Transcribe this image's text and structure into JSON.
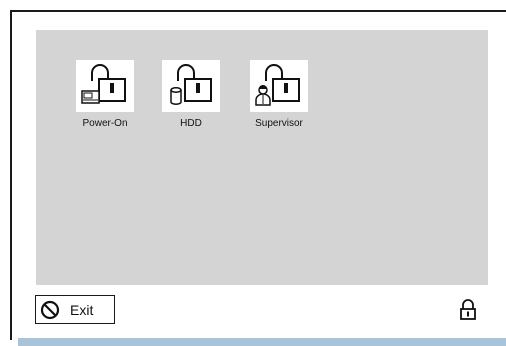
{
  "passwords": {
    "items": [
      {
        "label": "Power-On",
        "icon": "power-on-unlocked-icon"
      },
      {
        "label": "HDD",
        "icon": "hdd-unlocked-icon"
      },
      {
        "label": "Supervisor",
        "icon": "supervisor-unlocked-icon"
      }
    ]
  },
  "footer": {
    "exit_label": "Exit",
    "exit_icon": "no-entry-icon",
    "lock_icon": "padlock-icon"
  },
  "colors": {
    "panel": "#d4d4d4",
    "bottom_bar": "#a9c3d8"
  }
}
